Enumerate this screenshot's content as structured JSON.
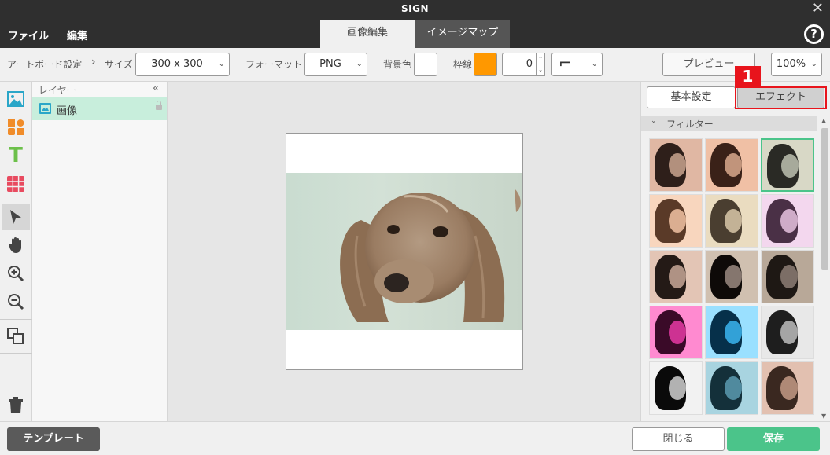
{
  "window": {
    "title": "SIGN",
    "close_glyph": "✕"
  },
  "menu": {
    "file": "ファイル",
    "edit": "編集",
    "tabs": [
      {
        "label": "画像編集",
        "active": true
      },
      {
        "label": "イメージマップ",
        "active": false
      }
    ],
    "help_glyph": "?"
  },
  "toolbar": {
    "artboard_settings": "アートボード設定",
    "arrow_glyph": "›",
    "size_label": "サイズ",
    "size_value": "300 x 300",
    "format_label": "フォーマット",
    "format_value": "PNG",
    "bg_color_label": "背景色",
    "bg_color": "#ffffff",
    "border_label": "枠線",
    "border_color": "#ff9800",
    "border_width": "0",
    "border_style_glyph": "⌐",
    "preview_label": "プレビュー",
    "zoom_value": "100%"
  },
  "left_tools": [
    {
      "name": "image-tool-icon"
    },
    {
      "name": "shape-tool-icon"
    },
    {
      "name": "text-tool-icon"
    },
    {
      "name": "table-tool-icon"
    },
    {
      "name": "select-tool-icon"
    },
    {
      "name": "hand-tool-icon"
    },
    {
      "name": "zoom-in-icon"
    },
    {
      "name": "zoom-out-icon"
    },
    {
      "name": "arrange-icon"
    },
    {
      "name": "trash-icon"
    }
  ],
  "text_tool_glyph": "T",
  "layers": {
    "header": "レイヤー",
    "collapse_glyph": "«",
    "items": [
      {
        "label": "画像"
      }
    ]
  },
  "right_panel": {
    "tab_basic": "基本設定",
    "tab_effect": "エフェクト",
    "annotation_number": "1",
    "filter_header": "フィルター",
    "chevron": "⌄",
    "filter_count": 15,
    "selected_filter_index": 2
  },
  "colors": {
    "accent_green": "#4bc48a",
    "annotation_red": "#e8141c",
    "dark_bar": "#2f2f2f"
  },
  "bottom": {
    "template_label": "テンプレート",
    "close_label": "閉じる",
    "save_label": "保存"
  }
}
